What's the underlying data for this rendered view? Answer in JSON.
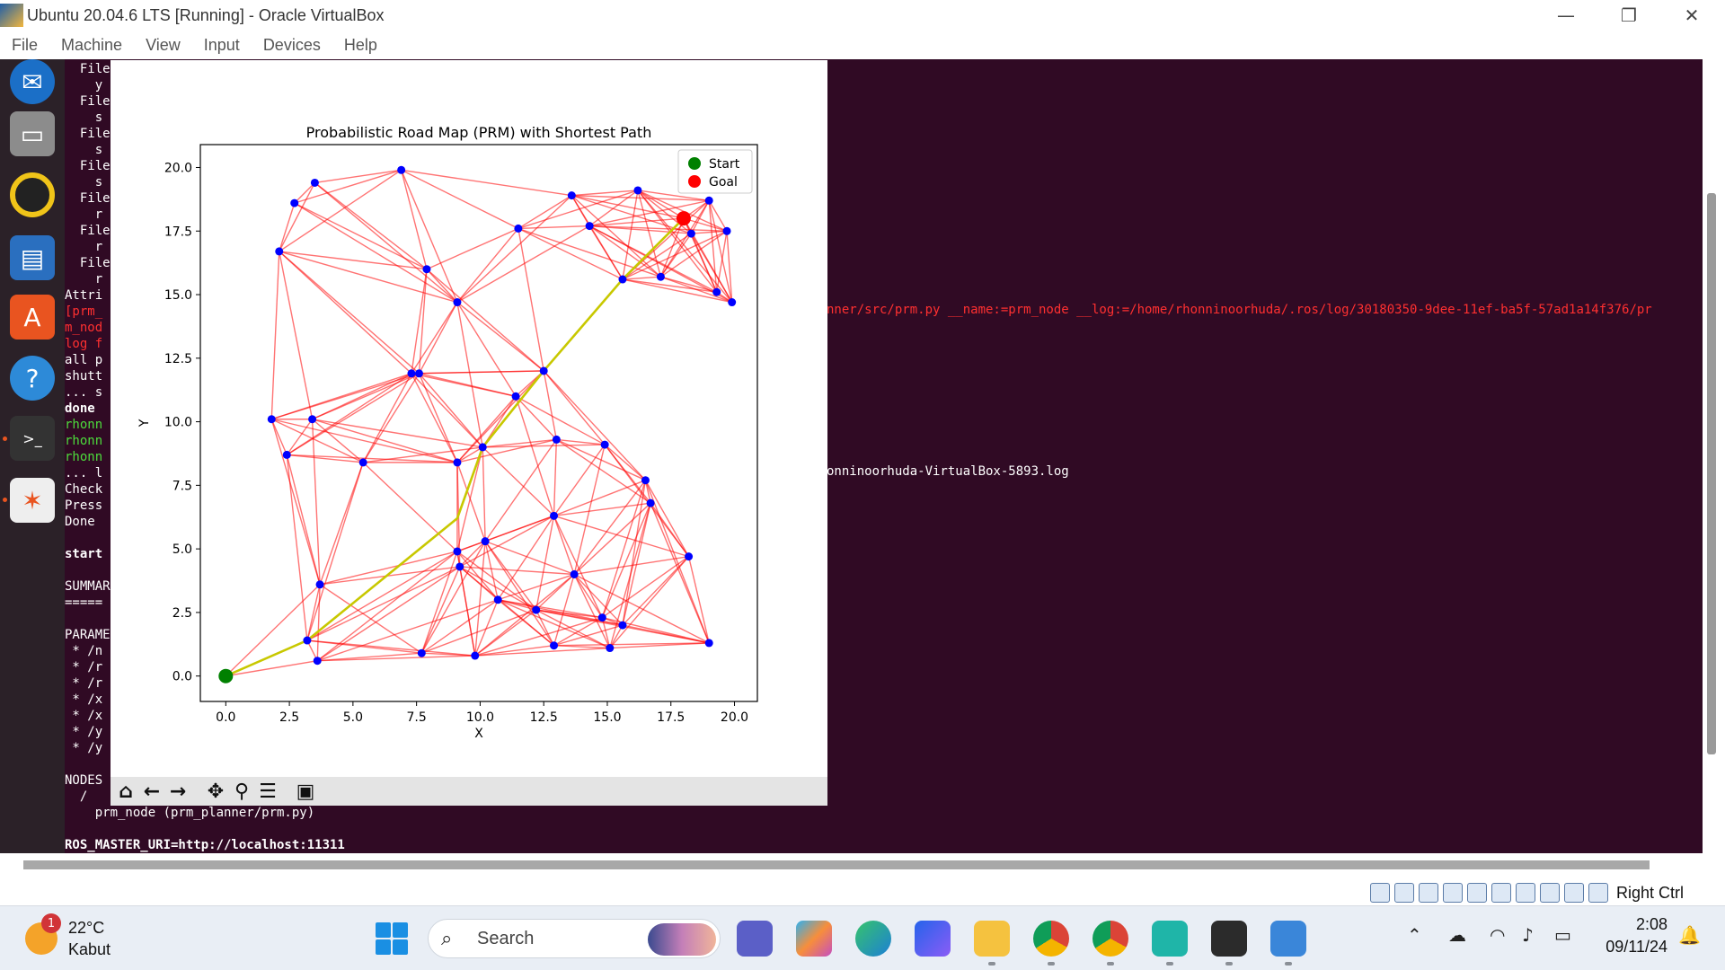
{
  "window": {
    "title": "Ubuntu 20.04.6 LTS [Running] - Oracle VirtualBox",
    "minimize": "—",
    "restore": "❐",
    "close": "✕"
  },
  "menu": [
    "File",
    "Machine",
    "View",
    "Input",
    "Devices",
    "Help"
  ],
  "terminal": {
    "lines_left": [
      {
        "t": "  File",
        "c": ""
      },
      {
        "t": "    y",
        "c": ""
      },
      {
        "t": "  File",
        "c": ""
      },
      {
        "t": "    s",
        "c": ""
      },
      {
        "t": "  File",
        "c": ""
      },
      {
        "t": "    s",
        "c": ""
      },
      {
        "t": "  File",
        "c": ""
      },
      {
        "t": "    s",
        "c": ""
      },
      {
        "t": "  File",
        "c": ""
      },
      {
        "t": "    r",
        "c": ""
      },
      {
        "t": "  File",
        "c": ""
      },
      {
        "t": "    r",
        "c": ""
      },
      {
        "t": "  File",
        "c": ""
      },
      {
        "t": "    r",
        "c": ""
      },
      {
        "t": "Attri",
        "c": ""
      },
      {
        "t": "[prm_",
        "c": "red"
      },
      {
        "t": "m_nod",
        "c": "red"
      },
      {
        "t": "log f",
        "c": "red"
      },
      {
        "t": "all p",
        "c": ""
      },
      {
        "t": "shutt",
        "c": ""
      },
      {
        "t": "... s",
        "c": ""
      },
      {
        "t": "done",
        "c": "bold"
      },
      {
        "t": "rhonn",
        "c": "green"
      },
      {
        "t": "rhonn",
        "c": "green"
      },
      {
        "t": "rhonn",
        "c": "green"
      },
      {
        "t": "... l",
        "c": ""
      },
      {
        "t": "Check",
        "c": ""
      },
      {
        "t": "Press",
        "c": ""
      },
      {
        "t": "Done",
        "c": ""
      }
    ],
    "started_line": "start",
    "summary_line": "SUMMAR",
    "separator_line": "=====",
    "params_header": "PARAME",
    "params": [
      " * /n",
      " * /r",
      " * /r",
      " * /x",
      " * /x",
      " * /y",
      " * /y"
    ],
    "nodes_header": "NODES",
    "nodes_root": "  /",
    "node_entry": "    prm_node (prm_planner/prm.py)",
    "ros_master": "ROS_MASTER_URI=http://localhost:11311",
    "right_red_line": "nner/src/prm.py __name:=prm_node __log:=/home/rhonninoorhuda/.ros/log/30180350-9dee-11ef-ba5f-57ad1a14f376/pr",
    "right_log_line": "onninoorhuda-VirtualBox-5893.log"
  },
  "toolbar_icons": [
    "home-icon",
    "back-icon",
    "forward-icon",
    "pan-icon",
    "zoom-icon",
    "configure-icon",
    "save-icon"
  ],
  "chart_data": {
    "type": "scatter",
    "title": "Probabilistic Road Map (PRM) with Shortest Path",
    "xlabel": "X",
    "ylabel": "Y",
    "xlim": [
      -1.0,
      20.9
    ],
    "ylim": [
      -1.0,
      20.9
    ],
    "xticks": [
      "0.0",
      "2.5",
      "5.0",
      "7.5",
      "10.0",
      "12.5",
      "15.0",
      "17.5",
      "20.0"
    ],
    "yticks": [
      "0.0",
      "2.5",
      "5.0",
      "7.5",
      "10.0",
      "12.5",
      "15.0",
      "17.5",
      "20.0"
    ],
    "legend": {
      "position": "top-right",
      "entries": [
        {
          "label": "Start",
          "color": "#008000"
        },
        {
          "label": "Goal",
          "color": "#ff0000"
        }
      ]
    },
    "start": [
      0,
      0
    ],
    "goal": [
      18,
      18
    ],
    "nodes": [
      [
        3.5,
        19.4
      ],
      [
        2.7,
        18.6
      ],
      [
        6.9,
        19.9
      ],
      [
        2.1,
        16.7
      ],
      [
        7.9,
        16.0
      ],
      [
        11.5,
        17.6
      ],
      [
        13.6,
        18.9
      ],
      [
        14.3,
        17.7
      ],
      [
        16.2,
        19.1
      ],
      [
        19.0,
        18.7
      ],
      [
        18.3,
        17.4
      ],
      [
        19.7,
        17.5
      ],
      [
        15.6,
        15.6
      ],
      [
        17.1,
        15.7
      ],
      [
        19.3,
        15.1
      ],
      [
        19.9,
        14.7
      ],
      [
        9.1,
        14.7
      ],
      [
        7.3,
        11.9
      ],
      [
        7.6,
        11.9
      ],
      [
        12.5,
        12.0
      ],
      [
        11.4,
        11.0
      ],
      [
        1.8,
        10.1
      ],
      [
        3.4,
        10.1
      ],
      [
        2.4,
        8.7
      ],
      [
        5.4,
        8.4
      ],
      [
        9.1,
        8.4
      ],
      [
        10.1,
        9.0
      ],
      [
        13.0,
        9.3
      ],
      [
        14.9,
        9.1
      ],
      [
        16.5,
        7.7
      ],
      [
        16.7,
        6.8
      ],
      [
        12.9,
        6.3
      ],
      [
        9.1,
        4.9
      ],
      [
        10.2,
        5.3
      ],
      [
        18.2,
        4.7
      ],
      [
        9.2,
        4.3
      ],
      [
        13.7,
        4.0
      ],
      [
        3.7,
        3.6
      ],
      [
        10.7,
        3.0
      ],
      [
        12.2,
        2.6
      ],
      [
        14.8,
        2.3
      ],
      [
        15.6,
        2.0
      ],
      [
        3.2,
        1.4
      ],
      [
        19.0,
        1.3
      ],
      [
        12.9,
        1.2
      ],
      [
        15.1,
        1.1
      ],
      [
        7.7,
        0.9
      ],
      [
        9.8,
        0.8
      ],
      [
        3.6,
        0.6
      ]
    ],
    "path": [
      [
        0,
        0
      ],
      [
        3.2,
        1.4
      ],
      [
        9.1,
        6.2
      ],
      [
        10.1,
        9.0
      ],
      [
        12.5,
        12.0
      ],
      [
        15.6,
        15.6
      ],
      [
        18,
        18
      ]
    ],
    "edge_color": "#ff0000",
    "path_color": "#c8c800",
    "node_color": "#0000ff"
  },
  "vbox_status": {
    "host_key": "Right Ctrl"
  },
  "taskbar": {
    "weather_temp": "22°C",
    "weather_cond": "Kabut",
    "weather_badge": "1",
    "search_label": "Search",
    "time": "2:08",
    "date": "09/11/24"
  }
}
